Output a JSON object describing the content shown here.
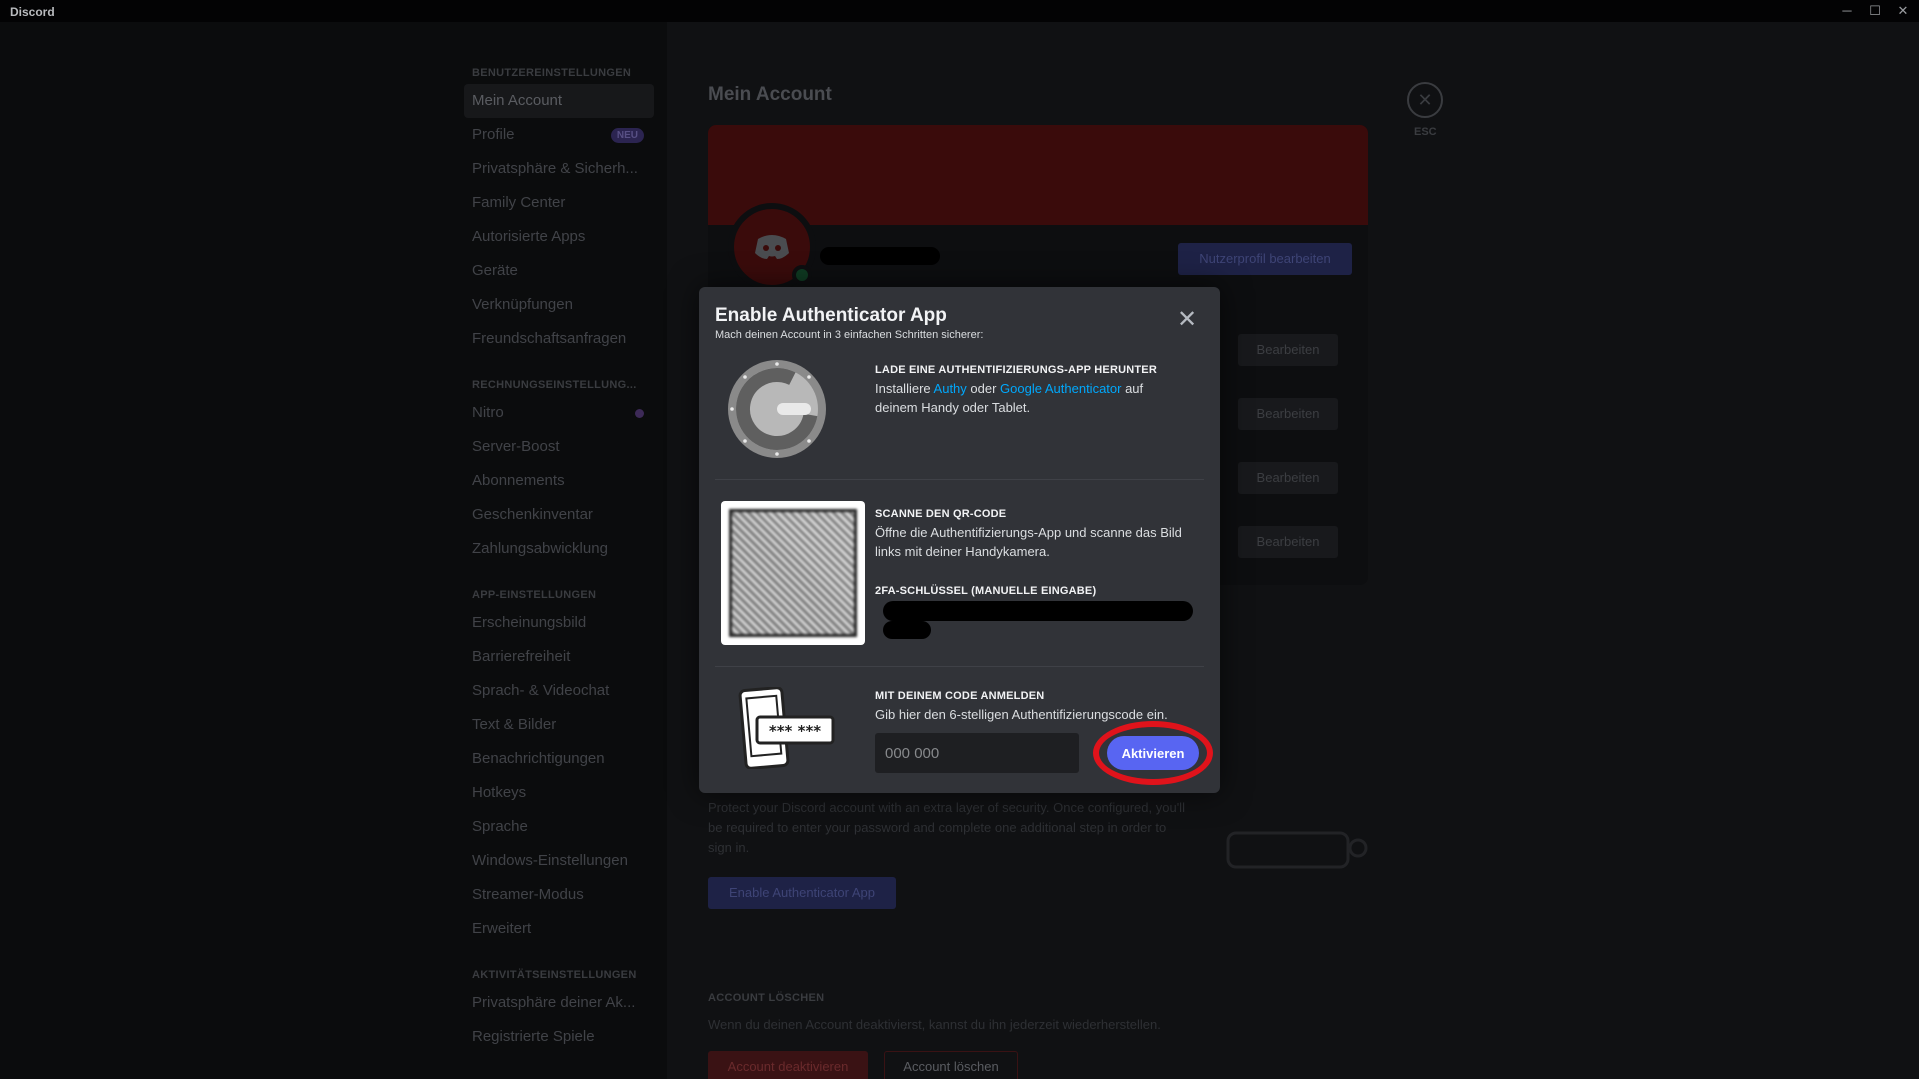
{
  "window": {
    "title": "Discord",
    "minimize_glyph": "─",
    "maximize_glyph": "☐",
    "close_glyph": "✕"
  },
  "sidebar": {
    "sections": [
      {
        "header": "BENUTZEREINSTELLUNGEN",
        "items": [
          {
            "label": "Mein Account",
            "selected": true
          },
          {
            "label": "Profile",
            "badge": "NEU"
          },
          {
            "label": "Privatsphäre & Sicherh..."
          },
          {
            "label": "Family Center"
          },
          {
            "label": "Autorisierte Apps"
          },
          {
            "label": "Geräte"
          },
          {
            "label": "Verknüpfungen"
          },
          {
            "label": "Freundschaftsanfragen"
          }
        ]
      },
      {
        "header": "RECHNUNGSEINSTELLUNG...",
        "items": [
          {
            "label": "Nitro",
            "dot": true
          },
          {
            "label": "Server-Boost"
          },
          {
            "label": "Abonnements"
          },
          {
            "label": "Geschenkinventar"
          },
          {
            "label": "Zahlungsabwicklung"
          }
        ]
      },
      {
        "header": "APP-EINSTELLUNGEN",
        "items": [
          {
            "label": "Erscheinungsbild"
          },
          {
            "label": "Barrierefreiheit"
          },
          {
            "label": "Sprach- & Videochat"
          },
          {
            "label": "Text & Bilder"
          },
          {
            "label": "Benachrichtigungen"
          },
          {
            "label": "Hotkeys"
          },
          {
            "label": "Sprache"
          },
          {
            "label": "Windows-Einstellungen"
          },
          {
            "label": "Streamer-Modus"
          },
          {
            "label": "Erweitert"
          }
        ]
      },
      {
        "header": "AKTIVITÄTSEINSTELLUNGEN",
        "items": [
          {
            "label": "Privatsphäre deiner Ak..."
          },
          {
            "label": "Registrierte Spiele"
          }
        ]
      }
    ]
  },
  "main": {
    "title": "Mein Account",
    "esc_label": "ESC",
    "edit_profile_label": "Nutzerprofil bearbeiten",
    "edit_label": "Bearbeiten",
    "twofa_text": "Protect your Discord account with an extra layer of security. Once configured, you'll be required to enter your password and complete one additional step in order to sign in.",
    "twofa_button": "Enable Authenticator App",
    "delete_header": "ACCOUNT LÖSCHEN",
    "delete_text": "Wenn du deinen Account deaktivierst, kannst du ihn jederzeit wiederherstellen.",
    "deactivate_button": "Account deaktivieren",
    "delete_button": "Account löschen"
  },
  "modal": {
    "title": "Enable Authenticator App",
    "subtitle": "Mach deinen Account in 3 einfachen Schritten sicherer:",
    "close_glyph": "✕",
    "step1": {
      "heading": "LADE EINE AUTHENTIFIZIERUNGS-APP HERUNTER",
      "text_pre": "Installiere ",
      "link1": "Authy",
      "text_mid": " oder ",
      "link2": "Google Authenticator",
      "text_post": " auf deinem Handy oder Tablet."
    },
    "step2": {
      "heading": "SCANNE DEN QR-CODE",
      "text": "Öffne die Authentifizierungs-App und scanne das Bild links mit deiner Handykamera.",
      "key_heading": "2FA-SCHLÜSSEL (MANUELLE EINGABE)"
    },
    "step3": {
      "heading": "MIT DEINEM CODE ANMELDEN",
      "text": "Gib hier den 6-stelligen Authentifizierungscode ein.",
      "input_placeholder": "000 000",
      "button": "Aktivieren",
      "phone_code": "*** ***"
    },
    "accent_color": "#5865f2",
    "highlight_color": "#e0131b",
    "link_color": "#00a8fc"
  }
}
